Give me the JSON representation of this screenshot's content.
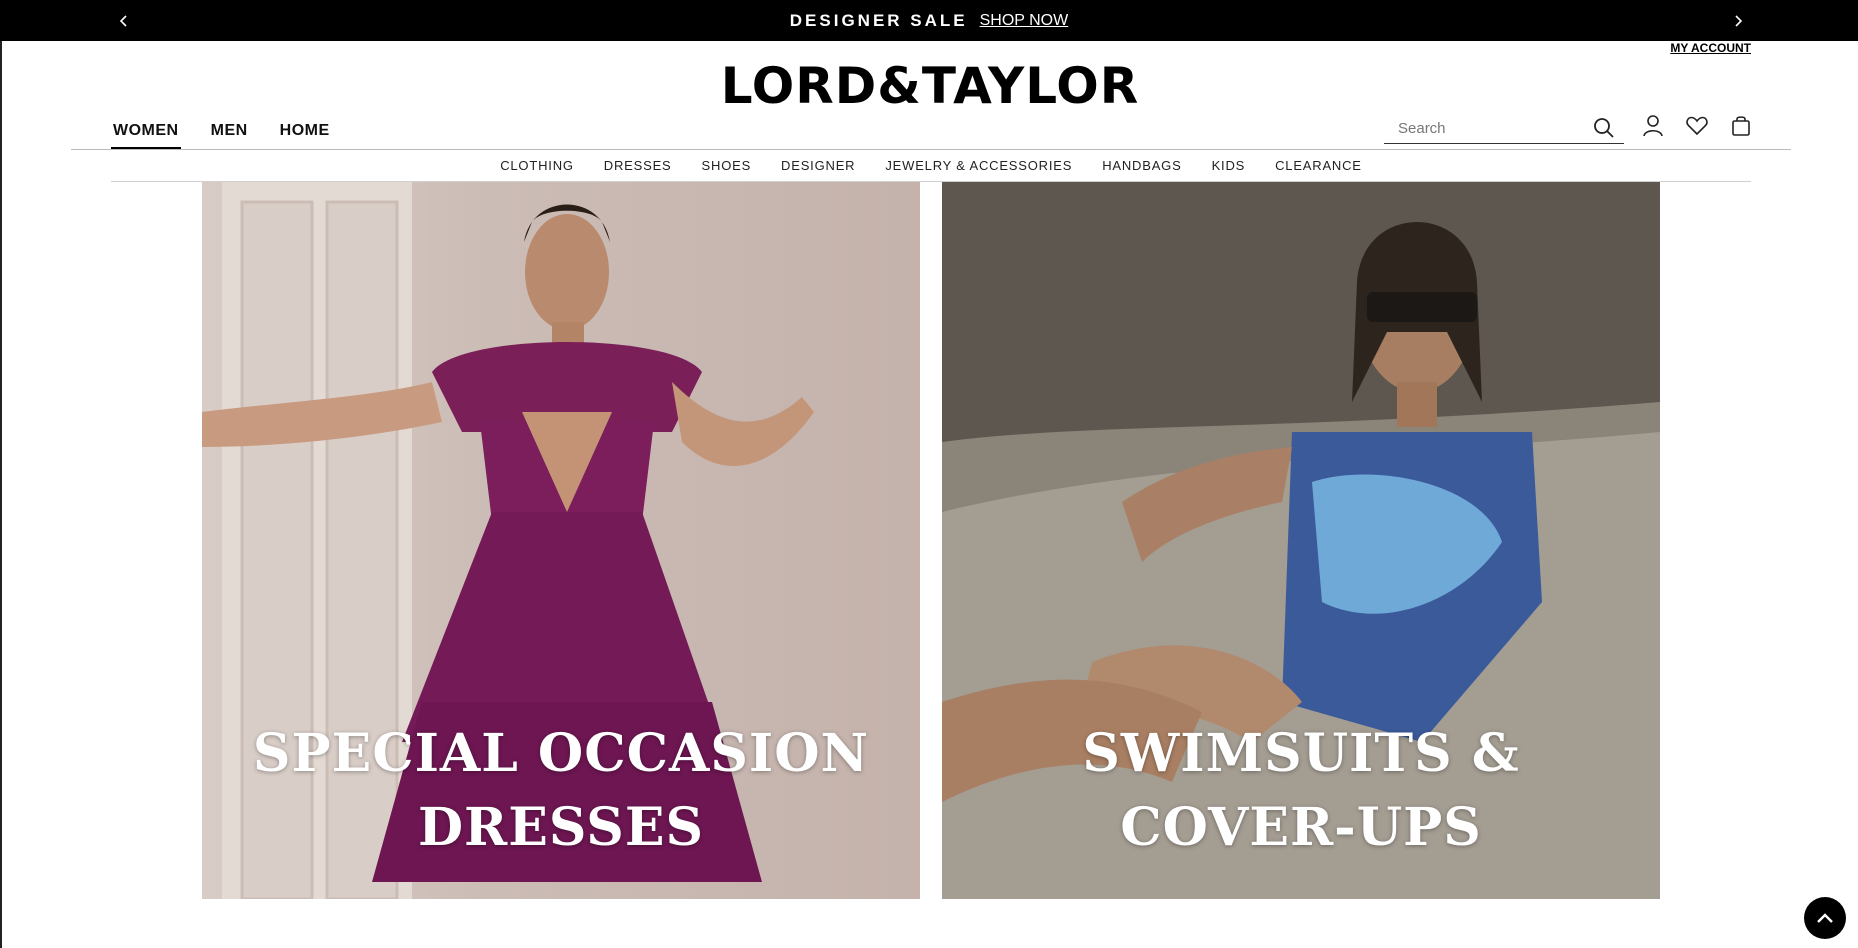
{
  "promo": {
    "text": "DESIGNER SALE",
    "link": "SHOP NOW"
  },
  "header": {
    "my_account": "MY ACCOUNT",
    "logo_text": "LORD&TAYLOR",
    "departments": [
      {
        "label": "WOMEN",
        "active": true
      },
      {
        "label": "MEN",
        "active": false
      },
      {
        "label": "HOME",
        "active": false
      }
    ],
    "search": {
      "placeholder": "Search",
      "value": ""
    }
  },
  "categories": [
    "CLOTHING",
    "DRESSES",
    "SHOES",
    "DESIGNER",
    "JEWELRY & ACCESSORIES",
    "HANDBAGS",
    "KIDS",
    "CLEARANCE"
  ],
  "tiles": [
    {
      "line1": "SPECIAL OCCASION",
      "line2": "DRESSES"
    },
    {
      "line1": "SWIMSUITS &",
      "line2": "COVER-UPS"
    }
  ],
  "icons": {
    "prev": "chevron-left-icon",
    "next": "chevron-right-icon",
    "search": "search-icon",
    "account": "user-icon",
    "wishlist": "heart-icon",
    "bag": "shopping-bag-icon",
    "back_to_top": "chevron-up-icon"
  },
  "colors": {
    "promo_bg": "#000000",
    "text": "#111111",
    "tile_caption": "#ffffff"
  }
}
